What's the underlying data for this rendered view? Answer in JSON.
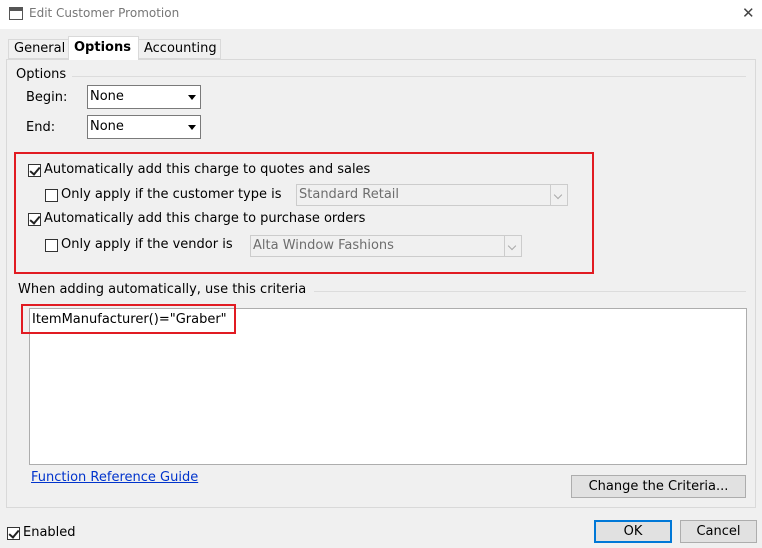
{
  "window": {
    "title": "Edit Customer Promotion",
    "close_glyph": "✕"
  },
  "tabs": [
    {
      "label": "General",
      "active": false
    },
    {
      "label": "Options",
      "active": true
    },
    {
      "label": "Accounting",
      "active": false
    }
  ],
  "options_group": {
    "label": "Options",
    "begin_label": "Begin:",
    "begin_value": "None",
    "end_label": "End:",
    "end_value": "None"
  },
  "auto_add": {
    "quotes_sales": {
      "label": "Automatically add this charge to quotes and sales",
      "checked": true
    },
    "customer_type": {
      "label": "Only apply if the customer type is",
      "checked": false,
      "value": "Standard Retail"
    },
    "purchase_orders": {
      "label": "Automatically add this charge to purchase orders",
      "checked": true
    },
    "vendor": {
      "label": "Only apply if the vendor is",
      "checked": false,
      "value": "Alta Window Fashions"
    }
  },
  "criteria": {
    "label": "When adding automatically, use this criteria",
    "expression": "ItemManufacturer()=\"Graber\"",
    "function_guide_link": "Function Reference Guide",
    "change_button": "Change the Criteria..."
  },
  "footer": {
    "enabled_label": "Enabled",
    "enabled_checked": true,
    "ok_label": "OK",
    "cancel_label": "Cancel"
  },
  "colors": {
    "highlight_box": "#e11b22",
    "link": "#0033cc",
    "default_button_border": "#0078d7"
  },
  "icons": [
    "window-icon",
    "close-icon",
    "chevron-down-icon",
    "checkbox-icon"
  ]
}
